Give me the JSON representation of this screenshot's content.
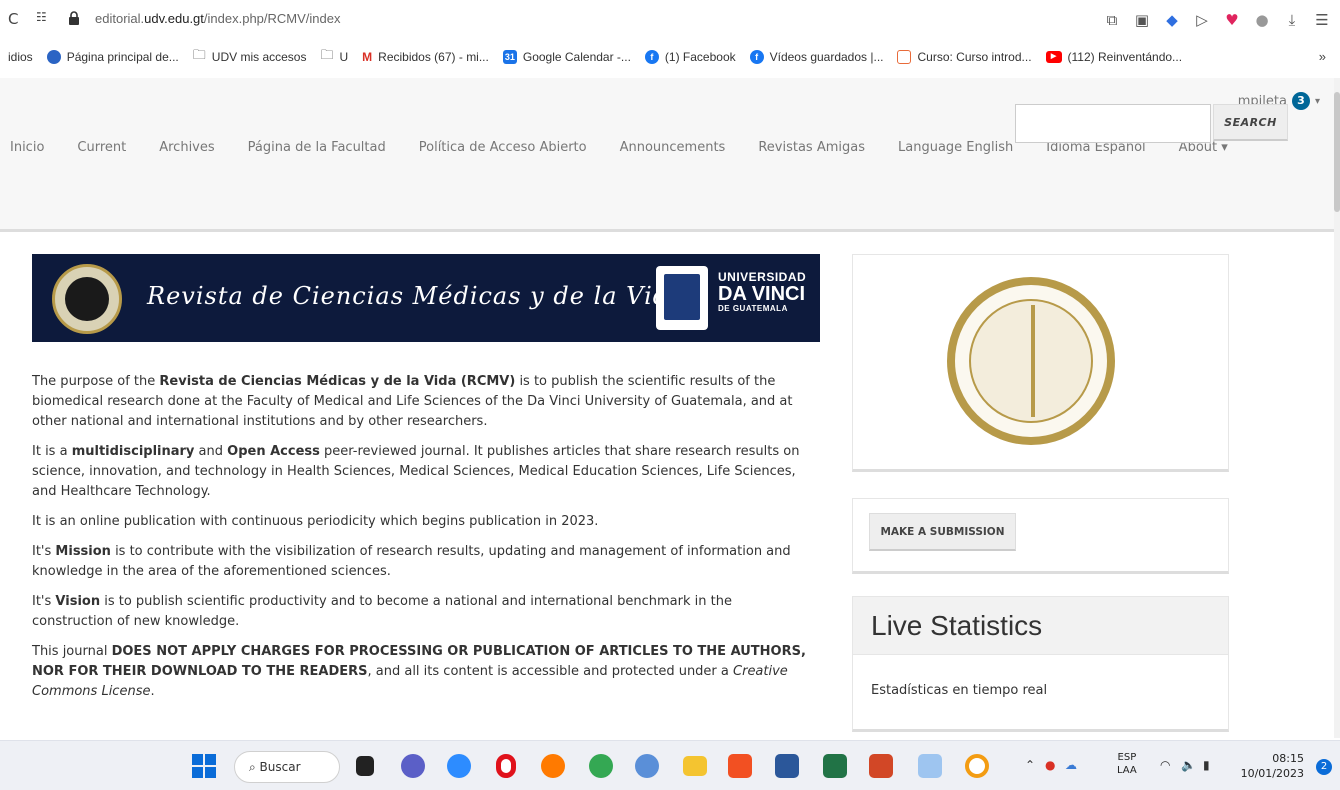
{
  "browser": {
    "url_prefix": "editorial.",
    "url_domain": "udv.edu.gt",
    "url_path": "/index.php/RCMV/index"
  },
  "bookmarks": {
    "items": [
      {
        "label": "idios",
        "color": ""
      },
      {
        "label": "Página principal de...",
        "color": "#2b64c4"
      },
      {
        "label": "UDV mis accesos",
        "color": "folder"
      },
      {
        "label": "U",
        "color": "folder"
      },
      {
        "label": "Recibidos (67) - mi...",
        "color": "#d93025"
      },
      {
        "label": "Google Calendar -...",
        "color": "#1a73e8"
      },
      {
        "label": "(1) Facebook",
        "color": "#1877f2"
      },
      {
        "label": "Vídeos guardados |...",
        "color": "#1877f2"
      },
      {
        "label": "Curso: Curso introd...",
        "color": "#e86b3a"
      },
      {
        "label": "(112) Reinventándo...",
        "color": "#ff0000"
      }
    ],
    "more": "»"
  },
  "header": {
    "username": "mpileta",
    "notifications": "3",
    "nav": [
      "Inicio",
      "Current",
      "Archives",
      "Página de la Facultad",
      "Política de Acceso Abierto",
      "Announcements",
      "Revistas Amigas",
      "Language English",
      "Idioma Español",
      "About ▾"
    ],
    "search_label": "SEARCH",
    "search_value": ""
  },
  "banner": {
    "title": "Revista de Ciencias Médicas y de la Vida",
    "uni_line1": "UNIVERSIDAD",
    "uni_line2": "DA VINCI",
    "uni_line3": "DE GUATEMALA"
  },
  "content": {
    "p1_a": "The purpose of the ",
    "p1_b": "Revista de Ciencias Médicas y de la Vida (RCMV)",
    "p1_c": " is to publish the scientific results of the biomedical research done at the Faculty of Medical and Life Sciences of the Da Vinci University of Guatemala, and at other national and international institutions and by other researchers.",
    "p2_a": "It is a ",
    "p2_b": "multidisciplinary",
    "p2_c": " and ",
    "p2_d": "Open Access",
    "p2_e": " peer-reviewed journal. It publishes articles that share research results on science, innovation, and technology in Health Sciences, Medical Sciences, Medical Education Sciences, Life Sciences, and Healthcare Technology.",
    "p3": "It is an online publication with continuous periodicity which begins publication in 2023.",
    "p4_a": "It's ",
    "p4_b": "Mission",
    "p4_c": " is to contribute with the visibilization of research results, updating and management of information and knowledge in the area of the aforementioned sciences.",
    "p5_a": "It's ",
    "p5_b": "Vision",
    "p5_c": " is to publish scientific productivity and to become a national and international benchmark in the construction of new knowledge.",
    "p6_a": "This journal ",
    "p6_b": "DOES NOT APPLY CHARGES FOR PROCESSING OR PUBLICATION OF ARTICLES TO THE AUTHORS, NOR FOR THEIR DOWNLOAD TO THE READERS",
    "p6_c": ", and all its content is accessible and protected under a ",
    "p6_d": "Creative Commons License",
    "p6_e": "."
  },
  "sidebar": {
    "submit_label": "MAKE A SUBMISSION",
    "stats_title": "Live Statistics",
    "stats_body": "Estadísticas en tiempo real"
  },
  "taskbar": {
    "search_label": "Buscar",
    "lang_line1": "ESP",
    "lang_line2": "LAA",
    "time": "08:15",
    "date": "10/01/2023",
    "notif_count": "2"
  }
}
